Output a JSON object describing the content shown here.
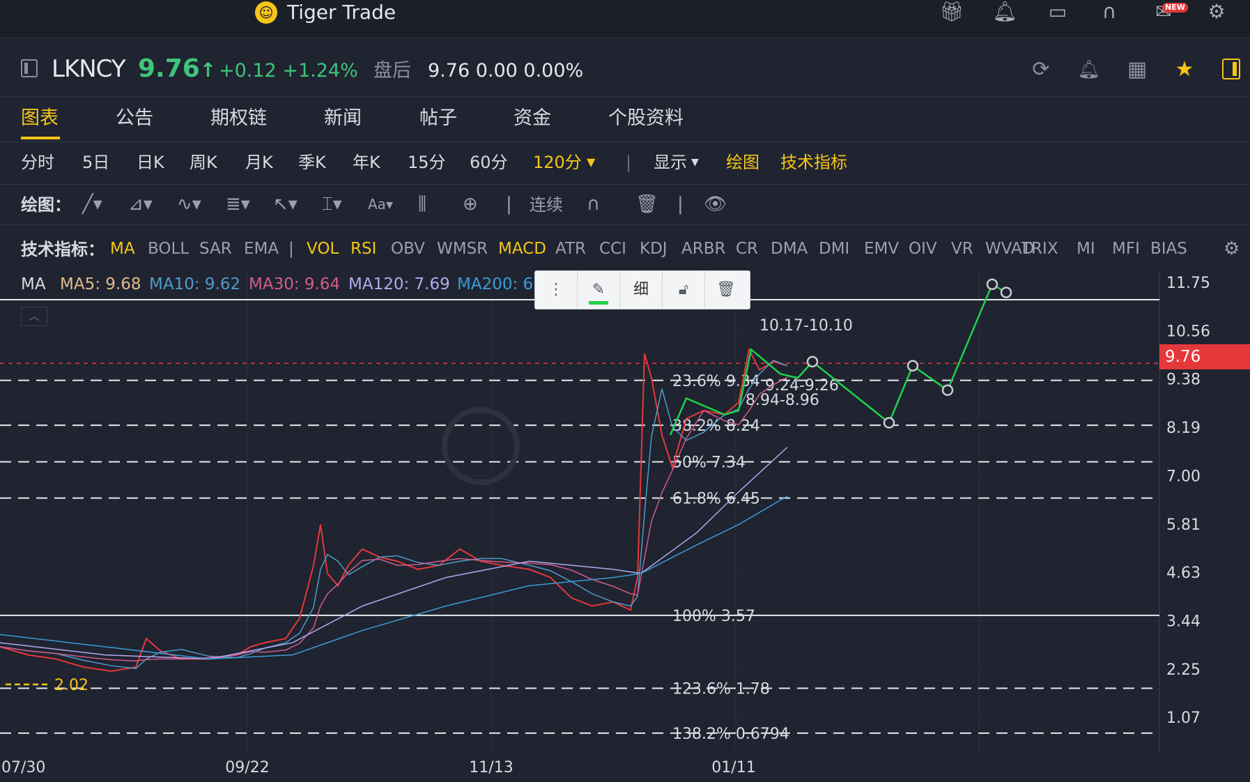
{
  "app": {
    "title": "Tiger Trade",
    "logo_icon": "tiger-logo-icon",
    "new_badge": "NEW"
  },
  "quote": {
    "symbol": "LKNCY",
    "price": "9.76",
    "price_arrow": "↑",
    "change": "+0.12 +1.24%",
    "after_hours_label": "盘后",
    "after_hours_value": "9.76 0.00 0.00%"
  },
  "tabs": [
    "图表",
    "公告",
    "期权链",
    "新闻",
    "帖子",
    "资金",
    "个股资料"
  ],
  "periods": [
    "分时",
    "5日",
    "日K",
    "周K",
    "月K",
    "季K",
    "年K",
    "15分",
    "60分",
    "120分"
  ],
  "period_active": "120分",
  "toolbar": {
    "display_label": "显示",
    "draw_label": "绘图",
    "indicators_label": "技术指标"
  },
  "drawing": {
    "label": "绘图：",
    "continuous_label": "连续"
  },
  "indicators": {
    "label": "技术指标：",
    "items": [
      "MA",
      "BOLL",
      "SAR",
      "EMA",
      "|",
      "VOL",
      "RSI",
      "OBV",
      "WMSR",
      "MACD",
      "ATR",
      "CCI",
      "KDJ",
      "ARBR",
      "CR",
      "DMA",
      "DMI",
      "EMV",
      "OIV",
      "VR",
      "WVAD",
      "TRIX",
      "MI",
      "MFI",
      "BIAS"
    ],
    "active": [
      "MA",
      "VOL",
      "RSI",
      "MACD"
    ]
  },
  "ma_legend": [
    {
      "text": "MA",
      "color": "#d7dbe3"
    },
    {
      "text": "MA5: 9.68",
      "color": "#e3b98a"
    },
    {
      "text": "MA10: 9.62",
      "color": "#4f9cc9"
    },
    {
      "text": "MA30: 9.64",
      "color": "#d25b8c"
    },
    {
      "text": "MA120: 7.69",
      "color": "#b4a8f0"
    },
    {
      "text": "MA200: 6.",
      "color": "#3d9bd6"
    }
  ],
  "float_toolbar": {
    "width_label": "细"
  },
  "chart_data": {
    "type": "line",
    "price_axis": [
      "11.75",
      "10.56",
      "9.38",
      "8.19",
      "7.00",
      "5.81",
      "4.63",
      "3.44",
      "2.25",
      "1.07"
    ],
    "date_axis": [
      "07/30",
      "09/22",
      "11/13",
      "01/11"
    ],
    "current_price": "9.76",
    "low_marker": "2.02",
    "fibonacci": [
      {
        "label": "23.6% 9.34",
        "value": 9.34
      },
      {
        "label": "38.2% 8.24",
        "value": 8.24
      },
      {
        "label": "50% 7.34",
        "value": 7.34
      },
      {
        "label": "61.8% 6.45",
        "value": 6.45
      },
      {
        "label": "100% 3.57",
        "value": 3.57
      },
      {
        "label": "123.6% 1.78",
        "value": 1.78
      },
      {
        "label": "138.2% 0.6794",
        "value": 0.6794
      }
    ],
    "price_labels": [
      "10.17-10.10",
      "9.24-9.26",
      "8.94-8.96"
    ]
  }
}
